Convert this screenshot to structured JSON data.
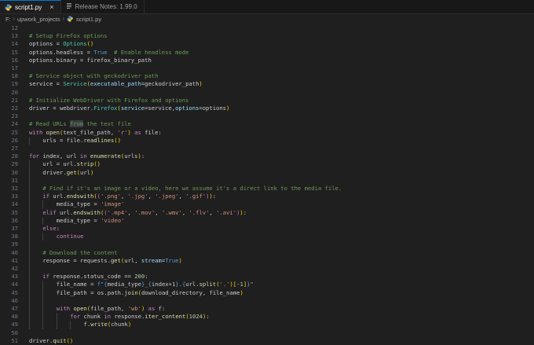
{
  "tabs": [
    {
      "label": "script1.py",
      "icon": "python-icon",
      "active": true,
      "close": "×"
    },
    {
      "label": "Release Notes: 1.99.0",
      "icon": "document-icon",
      "active": false
    }
  ],
  "breadcrumb": [
    "F:",
    "upwork_projects",
    "script1.py"
  ],
  "editor": {
    "lines": [
      {
        "n": "12",
        "indent": 0,
        "tokens": []
      },
      {
        "n": "13",
        "indent": 0,
        "tokens": [
          {
            "t": "# Setup Firefox options",
            "c": "c"
          }
        ]
      },
      {
        "n": "14",
        "indent": 0,
        "tokens": [
          {
            "t": "options = ",
            "c": ""
          },
          {
            "t": "Options",
            "c": "cl"
          },
          {
            "t": "()",
            "c": "br1"
          }
        ]
      },
      {
        "n": "15",
        "indent": 0,
        "tokens": [
          {
            "t": "options.headless = ",
            "c": ""
          },
          {
            "t": "True",
            "c": "b"
          },
          {
            "t": "  # Enable headless mode",
            "c": "c"
          }
        ]
      },
      {
        "n": "16",
        "indent": 0,
        "tokens": [
          {
            "t": "options.binary = firefox_binary_path",
            "c": ""
          }
        ]
      },
      {
        "n": "17",
        "indent": 0,
        "tokens": []
      },
      {
        "n": "18",
        "indent": 0,
        "tokens": [
          {
            "t": "# Service object with geckodriver path",
            "c": "c"
          }
        ]
      },
      {
        "n": "19",
        "indent": 0,
        "tokens": [
          {
            "t": "service = ",
            "c": ""
          },
          {
            "t": "Service",
            "c": "cl"
          },
          {
            "t": "(",
            "c": "br1"
          },
          {
            "t": "executable_path",
            "c": "p"
          },
          {
            "t": "=geckodriver_path",
            "c": ""
          },
          {
            "t": ")",
            "c": "br1"
          }
        ]
      },
      {
        "n": "20",
        "indent": 0,
        "tokens": []
      },
      {
        "n": "21",
        "indent": 0,
        "tokens": [
          {
            "t": "# Initialize WebDriver with Firefox and options",
            "c": "c"
          }
        ]
      },
      {
        "n": "22",
        "indent": 0,
        "tokens": [
          {
            "t": "driver = webdriver.",
            "c": ""
          },
          {
            "t": "Firefox",
            "c": "cl"
          },
          {
            "t": "(",
            "c": "br1"
          },
          {
            "t": "service",
            "c": "p"
          },
          {
            "t": "=service,",
            "c": ""
          },
          {
            "t": "options",
            "c": "p"
          },
          {
            "t": "=options",
            "c": ""
          },
          {
            "t": ")",
            "c": "br1"
          }
        ]
      },
      {
        "n": "23",
        "indent": 0,
        "tokens": []
      },
      {
        "n": "24",
        "indent": 0,
        "tokens": [
          {
            "t": "# Read URLs ",
            "c": "c"
          },
          {
            "t": "from",
            "c": "chl"
          },
          {
            "t": " the text file",
            "c": "c"
          }
        ]
      },
      {
        "n": "25",
        "indent": 0,
        "tokens": [
          {
            "t": "with ",
            "c": "k"
          },
          {
            "t": "open",
            "c": "f"
          },
          {
            "t": "(",
            "c": "br1"
          },
          {
            "t": "text_file_path, ",
            "c": ""
          },
          {
            "t": "'r'",
            "c": "s"
          },
          {
            "t": ")",
            "c": "br1"
          },
          {
            "t": " as ",
            "c": "k"
          },
          {
            "t": "file:",
            "c": ""
          }
        ]
      },
      {
        "n": "26",
        "indent": 1,
        "tokens": [
          {
            "t": "urls = file.",
            "c": ""
          },
          {
            "t": "readlines",
            "c": "f"
          },
          {
            "t": "()",
            "c": "br1"
          }
        ]
      },
      {
        "n": "27",
        "indent": 0,
        "tokens": []
      },
      {
        "n": "28",
        "indent": 0,
        "tokens": [
          {
            "t": "for ",
            "c": "k"
          },
          {
            "t": "index, url ",
            "c": ""
          },
          {
            "t": "in ",
            "c": "k"
          },
          {
            "t": "enumerate",
            "c": "f"
          },
          {
            "t": "(",
            "c": "br1"
          },
          {
            "t": "urls",
            "c": ""
          },
          {
            "t": ")",
            "c": "br1"
          },
          {
            "t": ":",
            "c": ""
          }
        ]
      },
      {
        "n": "29",
        "indent": 1,
        "tokens": [
          {
            "t": "url = url.",
            "c": ""
          },
          {
            "t": "strip",
            "c": "f"
          },
          {
            "t": "()",
            "c": "br1"
          }
        ]
      },
      {
        "n": "30",
        "indent": 1,
        "tokens": [
          {
            "t": "driver.",
            "c": ""
          },
          {
            "t": "get",
            "c": "f"
          },
          {
            "t": "(",
            "c": "br1"
          },
          {
            "t": "url",
            "c": ""
          },
          {
            "t": ")",
            "c": "br1"
          }
        ]
      },
      {
        "n": "31",
        "indent": 1,
        "tokens": []
      },
      {
        "n": "32",
        "indent": 1,
        "tokens": [
          {
            "t": "# Find if it's an image or a video, here we assume it's a direct link to the media file.",
            "c": "c"
          }
        ]
      },
      {
        "n": "33",
        "indent": 1,
        "tokens": [
          {
            "t": "if ",
            "c": "k"
          },
          {
            "t": "url.",
            "c": ""
          },
          {
            "t": "endswith",
            "c": "f"
          },
          {
            "t": "(",
            "c": "br1"
          },
          {
            "t": "(",
            "c": "br2"
          },
          {
            "t": "'.png'",
            "c": "s"
          },
          {
            "t": ", ",
            "c": ""
          },
          {
            "t": "'.jpg'",
            "c": "s"
          },
          {
            "t": ", ",
            "c": ""
          },
          {
            "t": "'.jpeg'",
            "c": "s"
          },
          {
            "t": ", ",
            "c": ""
          },
          {
            "t": "'.gif'",
            "c": "s"
          },
          {
            "t": ")",
            "c": "br2"
          },
          {
            "t": ")",
            "c": "br1"
          },
          {
            "t": ":",
            "c": ""
          }
        ]
      },
      {
        "n": "34",
        "indent": 2,
        "tokens": [
          {
            "t": "media_type = ",
            "c": ""
          },
          {
            "t": "'image'",
            "c": "s"
          }
        ]
      },
      {
        "n": "35",
        "indent": 1,
        "tokens": [
          {
            "t": "elif ",
            "c": "k"
          },
          {
            "t": "url.",
            "c": ""
          },
          {
            "t": "endswith",
            "c": "f"
          },
          {
            "t": "(",
            "c": "br1"
          },
          {
            "t": "(",
            "c": "br2"
          },
          {
            "t": "'.mp4'",
            "c": "s"
          },
          {
            "t": ", ",
            "c": ""
          },
          {
            "t": "'.mov'",
            "c": "s"
          },
          {
            "t": ", ",
            "c": ""
          },
          {
            "t": "'.wmv'",
            "c": "s"
          },
          {
            "t": ", ",
            "c": ""
          },
          {
            "t": "'.flv'",
            "c": "s"
          },
          {
            "t": ", ",
            "c": ""
          },
          {
            "t": "'.avi'",
            "c": "s"
          },
          {
            "t": ")",
            "c": "br2"
          },
          {
            "t": ")",
            "c": "br1"
          },
          {
            "t": ":",
            "c": ""
          }
        ]
      },
      {
        "n": "36",
        "indent": 2,
        "tokens": [
          {
            "t": "media_type = ",
            "c": ""
          },
          {
            "t": "'video'",
            "c": "s"
          }
        ]
      },
      {
        "n": "37",
        "indent": 1,
        "tokens": [
          {
            "t": "else",
            "c": "k"
          },
          {
            "t": ":",
            "c": ""
          }
        ]
      },
      {
        "n": "38",
        "indent": 2,
        "tokens": [
          {
            "t": "continue",
            "c": "k"
          }
        ]
      },
      {
        "n": "39",
        "indent": 1,
        "tokens": []
      },
      {
        "n": "40",
        "indent": 1,
        "tokens": [
          {
            "t": "# Download the content",
            "c": "c"
          }
        ]
      },
      {
        "n": "41",
        "indent": 1,
        "tokens": [
          {
            "t": "response = requests.",
            "c": ""
          },
          {
            "t": "get",
            "c": "f"
          },
          {
            "t": "(",
            "c": "br1"
          },
          {
            "t": "url, ",
            "c": ""
          },
          {
            "t": "stream",
            "c": "p"
          },
          {
            "t": "=",
            "c": ""
          },
          {
            "t": "True",
            "c": "b"
          },
          {
            "t": ")",
            "c": "br1"
          }
        ]
      },
      {
        "n": "42",
        "indent": 1,
        "tokens": []
      },
      {
        "n": "43",
        "indent": 1,
        "tokens": [
          {
            "t": "if ",
            "c": "k"
          },
          {
            "t": "response.status_code == ",
            "c": ""
          },
          {
            "t": "200",
            "c": "n"
          },
          {
            "t": ":",
            "c": ""
          }
        ]
      },
      {
        "n": "44",
        "indent": 2,
        "tokens": [
          {
            "t": "file_name = ",
            "c": ""
          },
          {
            "t": "f\"",
            "c": "b"
          },
          {
            "t": "{",
            "c": "b"
          },
          {
            "t": "media_type",
            "c": ""
          },
          {
            "t": "}",
            "c": "b"
          },
          {
            "t": "_",
            "c": "s"
          },
          {
            "t": "{",
            "c": "b"
          },
          {
            "t": "index+",
            "c": ""
          },
          {
            "t": "1",
            "c": "n"
          },
          {
            "t": "}",
            "c": "b"
          },
          {
            "t": ".",
            "c": "s"
          },
          {
            "t": "{",
            "c": "b"
          },
          {
            "t": "url.",
            "c": ""
          },
          {
            "t": "split",
            "c": "f"
          },
          {
            "t": "(",
            "c": "br1"
          },
          {
            "t": "'.'",
            "c": "s"
          },
          {
            "t": ")",
            "c": "br1"
          },
          {
            "t": "[",
            "c": "br1"
          },
          {
            "t": "-1",
            "c": "n"
          },
          {
            "t": "]",
            "c": "br1"
          },
          {
            "t": "}",
            "c": "b"
          },
          {
            "t": "\"",
            "c": "s"
          }
        ]
      },
      {
        "n": "45",
        "indent": 2,
        "tokens": [
          {
            "t": "file_path = os.path.",
            "c": ""
          },
          {
            "t": "join",
            "c": "f"
          },
          {
            "t": "(",
            "c": "br1"
          },
          {
            "t": "download_directory, file_name",
            "c": ""
          },
          {
            "t": ")",
            "c": "br1"
          }
        ]
      },
      {
        "n": "46",
        "indent": 2,
        "tokens": []
      },
      {
        "n": "47",
        "indent": 2,
        "tokens": [
          {
            "t": "with ",
            "c": "k"
          },
          {
            "t": "open",
            "c": "f"
          },
          {
            "t": "(",
            "c": "br1"
          },
          {
            "t": "file_path, ",
            "c": ""
          },
          {
            "t": "'wb'",
            "c": "s"
          },
          {
            "t": ")",
            "c": "br1"
          },
          {
            "t": " as ",
            "c": "k"
          },
          {
            "t": "f:",
            "c": ""
          }
        ]
      },
      {
        "n": "48",
        "indent": 3,
        "tokens": [
          {
            "t": "for ",
            "c": "k"
          },
          {
            "t": "chunk ",
            "c": ""
          },
          {
            "t": "in ",
            "c": "k"
          },
          {
            "t": "response.",
            "c": ""
          },
          {
            "t": "iter_content",
            "c": "f"
          },
          {
            "t": "(",
            "c": "br1"
          },
          {
            "t": "1024",
            "c": "n"
          },
          {
            "t": ")",
            "c": "br1"
          },
          {
            "t": ":",
            "c": ""
          }
        ]
      },
      {
        "n": "49",
        "indent": 4,
        "tokens": [
          {
            "t": "f.",
            "c": ""
          },
          {
            "t": "write",
            "c": "f"
          },
          {
            "t": "(",
            "c": "br1"
          },
          {
            "t": "chunk",
            "c": ""
          },
          {
            "t": ")",
            "c": "br1"
          }
        ]
      },
      {
        "n": "50",
        "indent": 0,
        "tokens": []
      },
      {
        "n": "51",
        "indent": 0,
        "tokens": [
          {
            "t": "driver.",
            "c": ""
          },
          {
            "t": "quit",
            "c": "f"
          },
          {
            "t": "()",
            "c": "br1"
          }
        ]
      }
    ]
  }
}
